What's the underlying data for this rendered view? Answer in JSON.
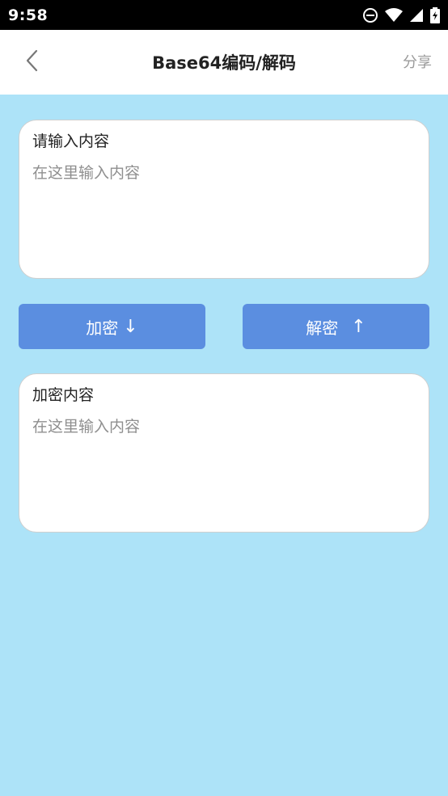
{
  "status_bar": {
    "time": "9:58"
  },
  "app_bar": {
    "title": "Base64编码/解码",
    "share_label": "分享"
  },
  "input_card": {
    "label": "请输入内容",
    "placeholder": "在这里输入内容"
  },
  "buttons": {
    "encode_label": "加密",
    "encode_arrow": "↓",
    "decode_label": "解密",
    "decode_arrow": "↑"
  },
  "output_card": {
    "label": "加密内容",
    "placeholder": "在这里输入内容"
  },
  "colors": {
    "background": "#ade3f8",
    "button": "#5b8ee0",
    "app_bar": "#ffffff"
  }
}
